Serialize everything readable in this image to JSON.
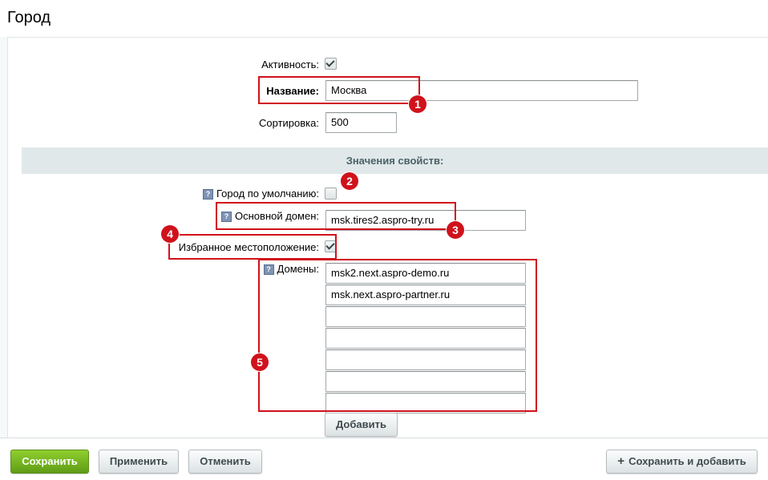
{
  "page": {
    "title": "Город"
  },
  "form": {
    "active_label": "Активность:",
    "active_checked": true,
    "name_label": "Название:",
    "name_value": "Москва",
    "sort_label": "Сортировка:",
    "sort_value": "500"
  },
  "properties": {
    "section_title": "Значения свойств:",
    "default_city_label": "Город по умолчанию:",
    "default_city_checked": false,
    "main_domain_label": "Основной домен:",
    "main_domain_value": "msk.tires2.aspro-try.ru",
    "favorite_label": "Избранное местоположение:",
    "favorite_checked": true,
    "domains_label": "Домены:",
    "domains": [
      "msk2.next.aspro-demo.ru",
      "msk.next.aspro-partner.ru",
      "",
      "",
      "",
      "",
      ""
    ],
    "add_label": "Добавить",
    "help_glyph": "?"
  },
  "markers": [
    "1",
    "2",
    "3",
    "4",
    "5"
  ],
  "footer": {
    "save_label": "Сохранить",
    "apply_label": "Применить",
    "cancel_label": "Отменить",
    "save_add_label": "Сохранить и добавить",
    "plus_glyph": "+"
  },
  "colors": {
    "accent_red": "#d0121b",
    "save_green": "#6fb51f",
    "section_bg": "#e0e8ea"
  }
}
